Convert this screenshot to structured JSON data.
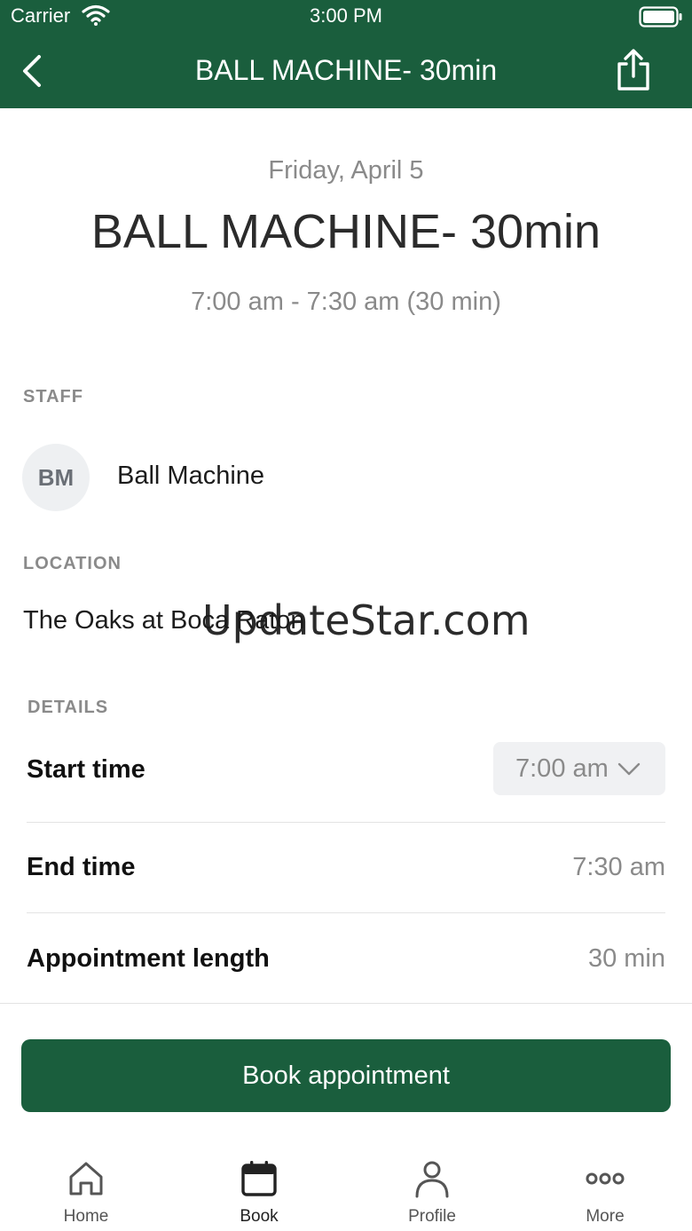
{
  "status_bar": {
    "carrier": "Carrier",
    "time": "3:00 PM"
  },
  "nav": {
    "title": "BALL MACHINE- 30min"
  },
  "summary": {
    "date": "Friday, April 5",
    "title": "BALL MACHINE- 30min",
    "time_range": "7:00 am - 7:30 am (30 min)"
  },
  "staff": {
    "label": "STAFF",
    "initials": "BM",
    "name": "Ball Machine"
  },
  "location": {
    "label": "LOCATION",
    "name": "The Oaks at Boca Raton"
  },
  "watermark": "UpdateStar.com",
  "details": {
    "label": "DETAILS",
    "start_label": "Start time",
    "start_value": "7:00 am",
    "end_label": "End time",
    "end_value": "7:30 am",
    "length_label": "Appointment length",
    "length_value": "30 min"
  },
  "book_button": "Book appointment",
  "tabs": [
    {
      "label": "Home",
      "icon": "home-icon"
    },
    {
      "label": "Book",
      "icon": "calendar-icon"
    },
    {
      "label": "Profile",
      "icon": "person-icon"
    },
    {
      "label": "More",
      "icon": "more-icon"
    }
  ],
  "colors": {
    "brand": "#1a5e3d",
    "muted": "#8a8a8a"
  }
}
